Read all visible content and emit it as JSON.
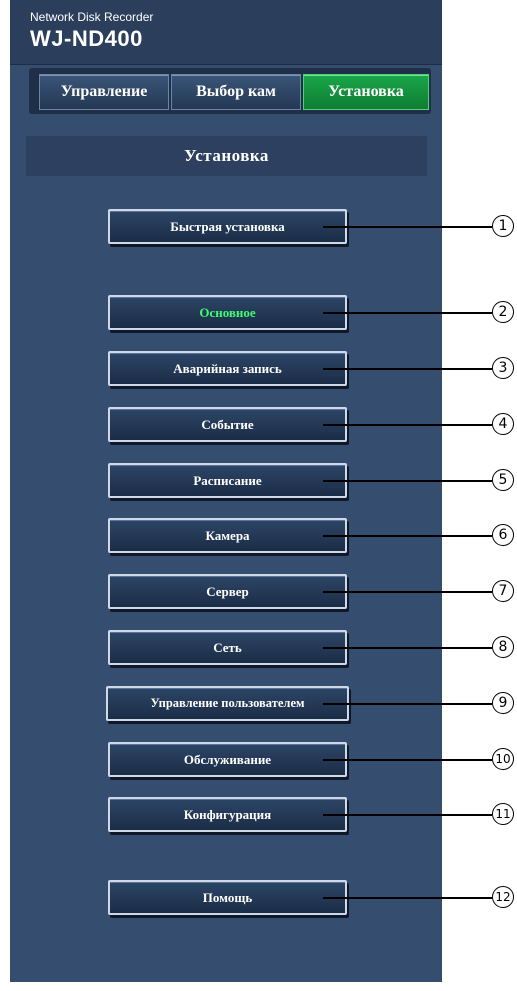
{
  "header": {
    "brand_line1": "Network Disk Recorder",
    "brand_line2": "WJ-ND400"
  },
  "tabs": [
    {
      "label": "Управление",
      "active": false
    },
    {
      "label": "Выбор кам",
      "active": false
    },
    {
      "label": "Установка",
      "active": true
    }
  ],
  "section_title": "Установка",
  "menu": {
    "items": [
      {
        "label": "Быстрая установка",
        "number": "1"
      },
      {
        "label": "Основное",
        "number": "2",
        "selected": true
      },
      {
        "label": "Аварийная запись",
        "number": "3"
      },
      {
        "label": "Событие",
        "number": "4"
      },
      {
        "label": "Расписание",
        "number": "5"
      },
      {
        "label": "Камера",
        "number": "6"
      },
      {
        "label": "Сервер",
        "number": "7"
      },
      {
        "label": "Сеть",
        "number": "8"
      },
      {
        "label": "Управление пользователем",
        "number": "9"
      },
      {
        "label": "Обслуживание",
        "number": "10"
      },
      {
        "label": "Конфигурация",
        "number": "11"
      },
      {
        "label": "Помощь",
        "number": "12"
      }
    ]
  },
  "colors": {
    "panel": "#354d6e",
    "active_tab": "#1aa64a",
    "selected_text": "#3cff6e"
  }
}
